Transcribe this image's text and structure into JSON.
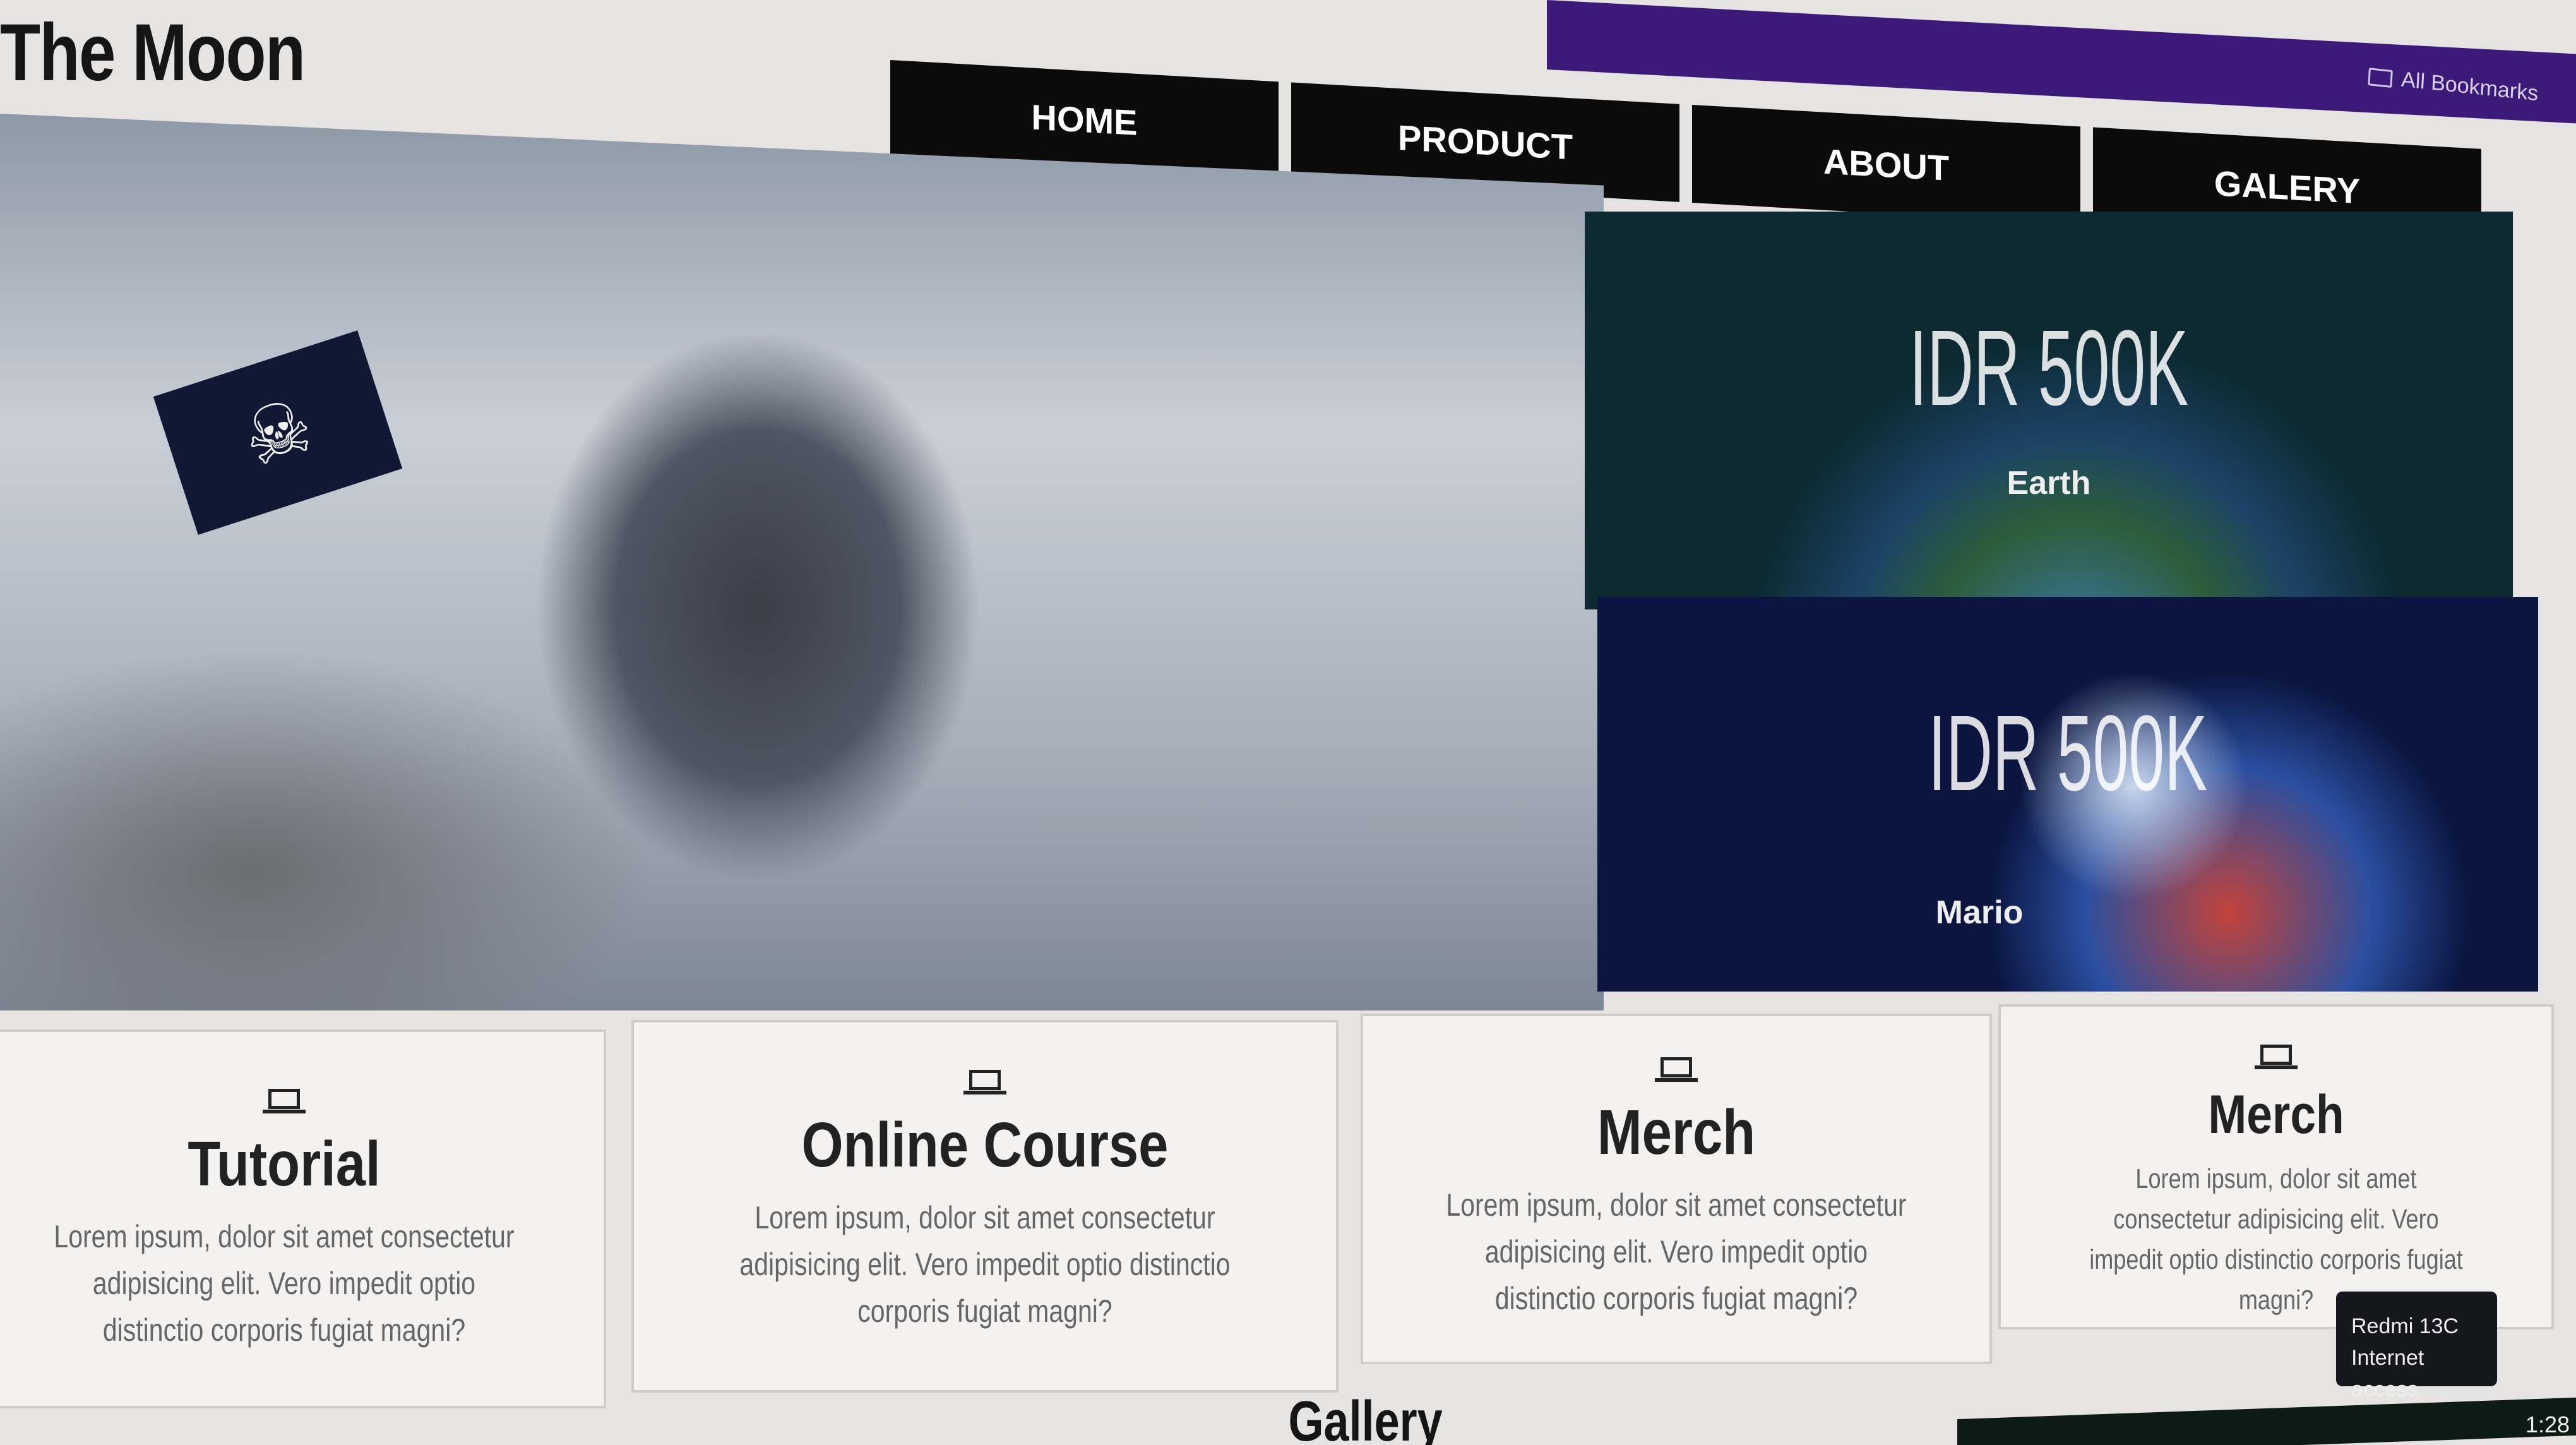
{
  "browser": {
    "bookmarks_label": "All Bookmarks",
    "accent": "#3b1a7a"
  },
  "site": {
    "title": "The Moon"
  },
  "nav": [
    {
      "label": "HOME"
    },
    {
      "label": "PRODUCT"
    },
    {
      "label": "ABOUT"
    },
    {
      "label": "GALERY"
    }
  ],
  "products": [
    {
      "price": "IDR 500K",
      "name": "Earth"
    },
    {
      "price": "IDR 500K",
      "name": "Mario"
    }
  ],
  "cards": [
    {
      "icon": "laptop-icon",
      "title": "Tutorial",
      "text": "Lorem ipsum, dolor sit amet consectetur adipisicing elit. Vero impedit optio distinctio corporis fugiat magni?"
    },
    {
      "icon": "laptop-icon",
      "title": "Online Course",
      "text": "Lorem ipsum, dolor sit amet consectetur adipisicing elit. Vero impedit optio distinctio corporis fugiat magni?"
    },
    {
      "icon": "laptop-icon",
      "title": "Merch",
      "text": "Lorem ipsum, dolor sit amet consectetur adipisicing elit. Vero impedit optio distinctio corporis fugiat magni?"
    },
    {
      "icon": "laptop-icon",
      "title": "Merch",
      "text": "Lorem ipsum, dolor sit amet consectetur adipisicing elit. Vero impedit optio distinctio corporis fugiat magni?"
    }
  ],
  "gallery": {
    "heading": "Gallery"
  },
  "tooltip": {
    "line1": "Redmi 13C",
    "line2": "Internet access"
  },
  "taskbar": {
    "clock": "1:28"
  }
}
